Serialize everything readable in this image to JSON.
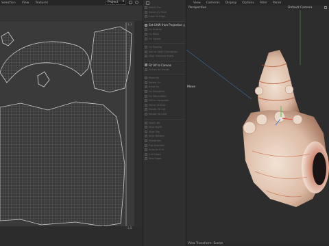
{
  "left_panel": {
    "menu": [
      "Selection",
      "View",
      "Textures"
    ],
    "project_select": "Project",
    "corner_top": "1,1",
    "corner_bottom": "1,0"
  },
  "tools": {
    "items": [
      {
        "label": "Select Uvs",
        "active": false
      },
      {
        "label": "Select Uv Shell",
        "active": false
      },
      {
        "label": "Loop Uv Edge",
        "active": false
      },
      {
        "label": "",
        "active": false
      },
      {
        "label": "Set UVW from Projection",
        "active": true,
        "dot": true
      },
      {
        "label": "Uv Unwrap",
        "active": false
      },
      {
        "label": "Uv Relax",
        "active": false
      },
      {
        "label": "Uv Layout",
        "active": false
      },
      {
        "label": "",
        "active": false
      },
      {
        "label": "Uv Packing",
        "active": false
      },
      {
        "label": "Set Uv Shell Orientation",
        "active": false
      },
      {
        "label": "Align Selected Shells",
        "active": false
      },
      {
        "label": "",
        "active": false
      },
      {
        "label": "Fit UV to Canvas",
        "active": true
      },
      {
        "label": "Fit Uvs to Canvas",
        "active": false
      },
      {
        "label": "",
        "active": false
      },
      {
        "label": "Move Uv",
        "active": false
      },
      {
        "label": "Rotate Uv",
        "active": false
      },
      {
        "label": "Scale Uv",
        "active": false
      },
      {
        "label": "Uv Transform",
        "active": false
      },
      {
        "label": "Uv Stitch/Weld",
        "active": false
      },
      {
        "label": "Mirror Horizontal",
        "active": false
      },
      {
        "label": "Mirror Vertical",
        "active": false
      },
      {
        "label": "Rotate 90 CW",
        "active": false
      },
      {
        "label": "Rotate 90 CCW",
        "active": false
      },
      {
        "label": "",
        "active": false
      },
      {
        "label": "Align Left",
        "active": false
      },
      {
        "label": "Align Right",
        "active": false
      },
      {
        "label": "Align Top",
        "active": false
      },
      {
        "label": "Align Bottom",
        "active": false
      },
      {
        "label": "Straighten",
        "active": false
      },
      {
        "label": "Flip Selected",
        "active": false
      },
      {
        "label": "Snap to Grid",
        "active": false
      },
      {
        "label": "Cut Edges",
        "active": false
      },
      {
        "label": "Sew Edges",
        "active": false
      }
    ]
  },
  "viewport": {
    "menu": [
      "View",
      "Cameras",
      "Display",
      "Options",
      "Filter",
      "Panel"
    ],
    "mode": "Perspective",
    "camera": "Default Camera",
    "move_label": "Move",
    "footer": "View Transform: Scene"
  },
  "colors": {
    "accent": "#d0d0d0",
    "shell_base": "#e8d6c8",
    "shell_orange": "#c7623a"
  }
}
